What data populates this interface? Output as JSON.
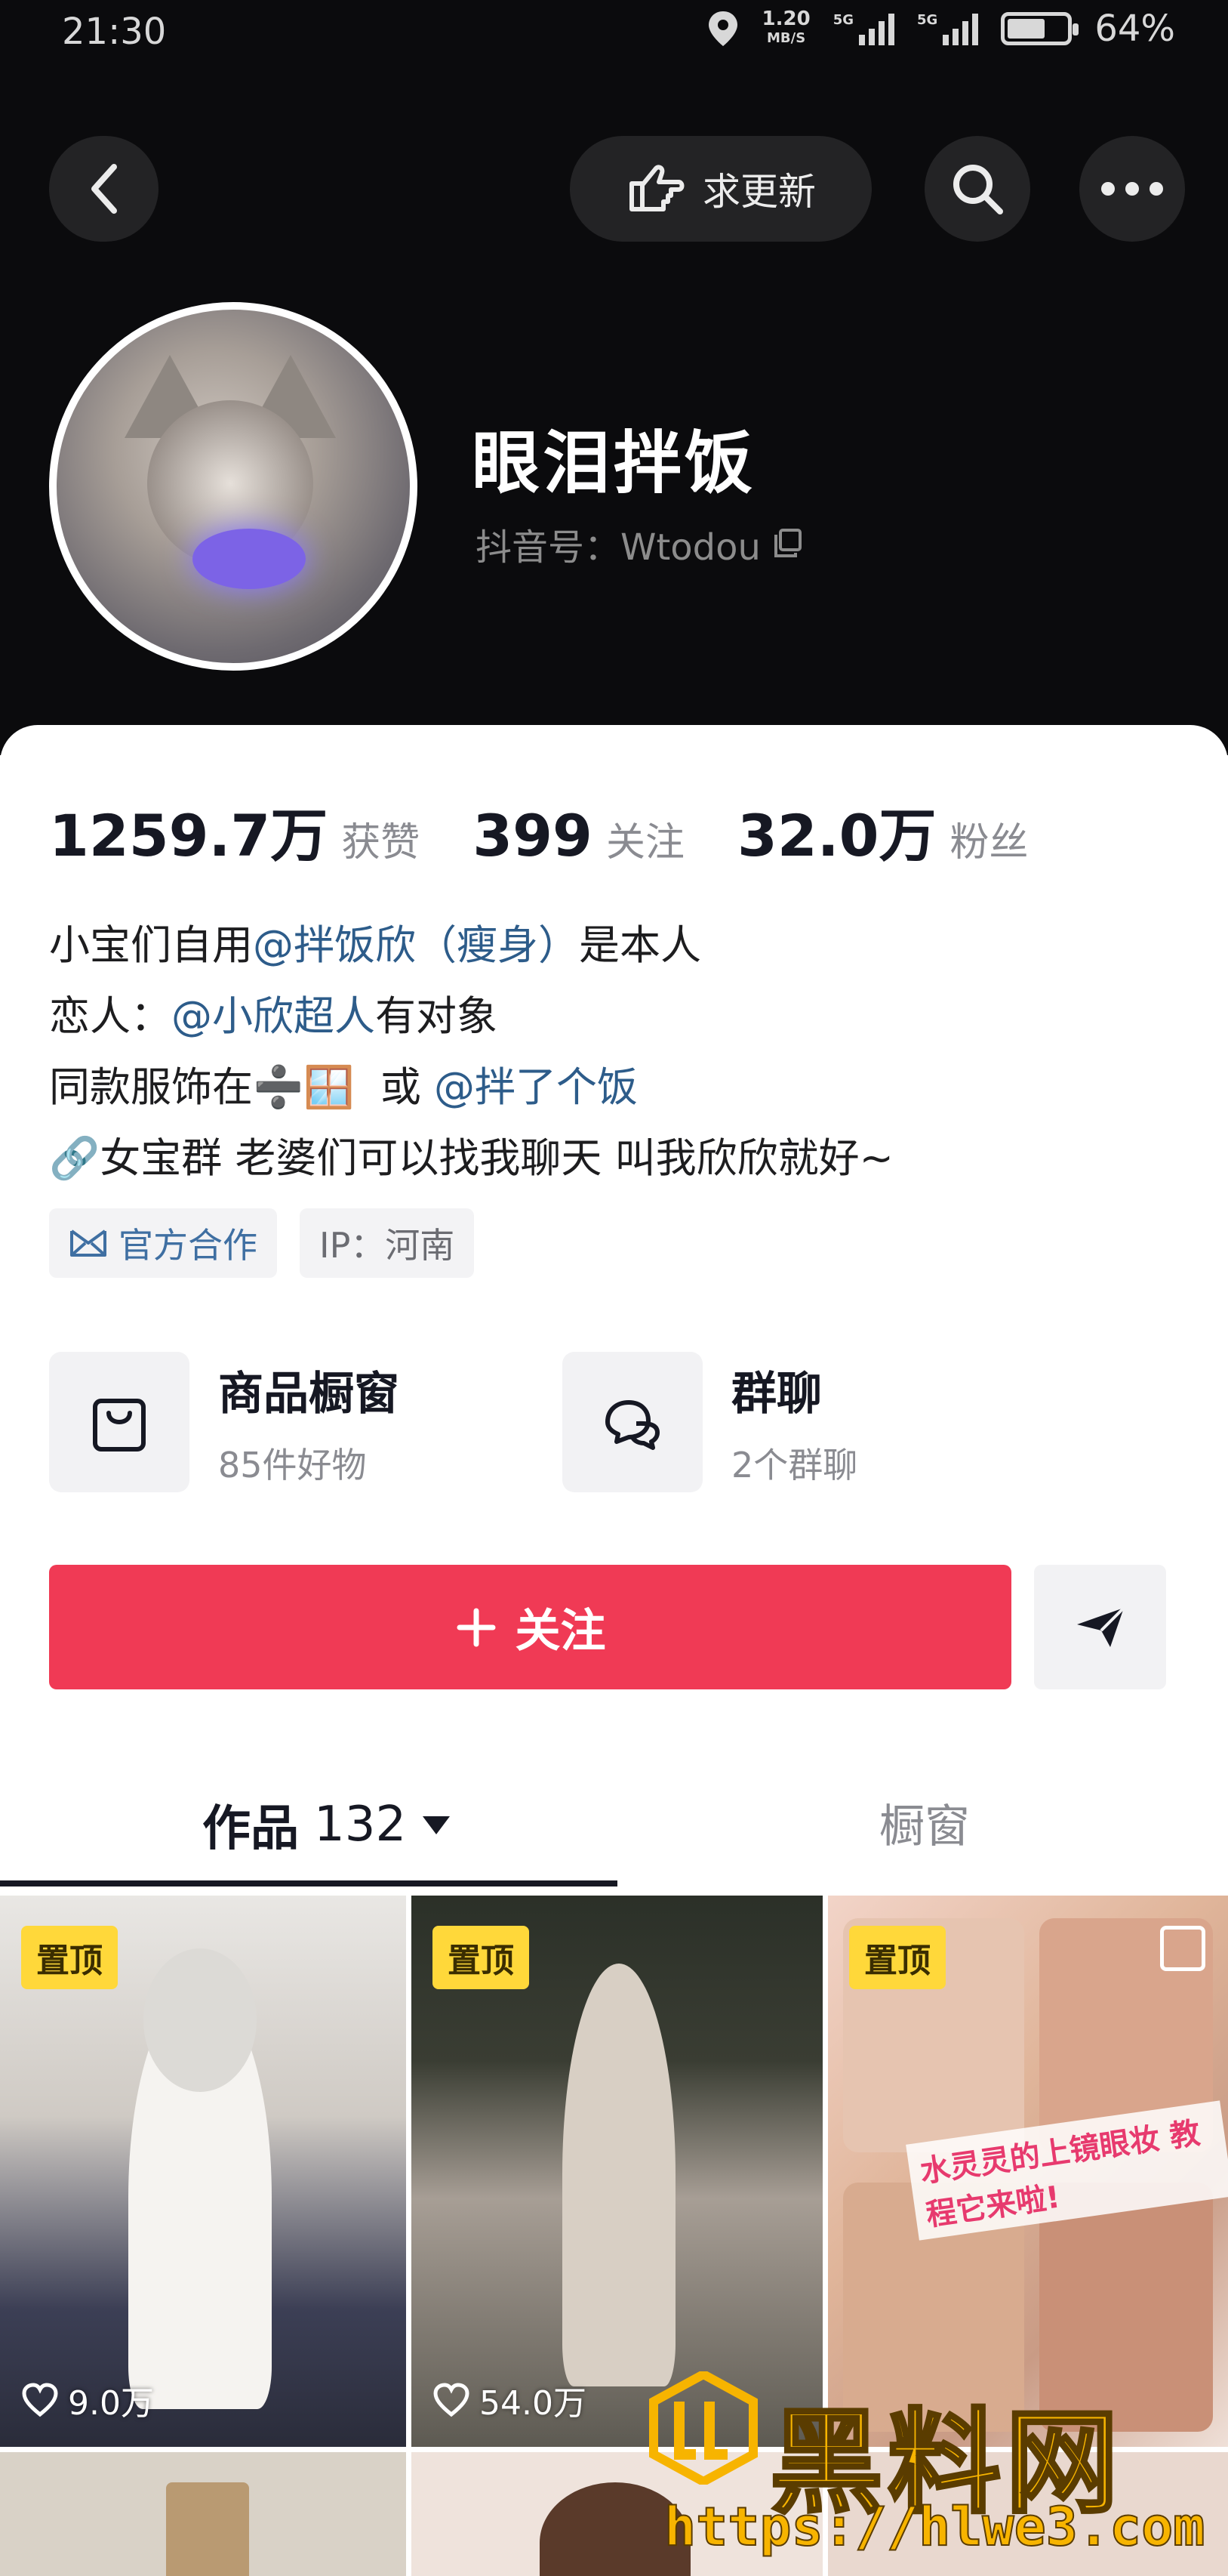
{
  "status": {
    "time": "21:30",
    "speed_value": "1.20",
    "speed_unit": "MB/S",
    "net1": "5G",
    "net2": "5G",
    "battery": "64%",
    "battery_level": 0.64
  },
  "header": {
    "update_label": "求更新"
  },
  "profile": {
    "name": "眼泪拌饭",
    "account": "抖音号：Wtodou"
  },
  "stats": {
    "likes_value": "1259.7万",
    "likes_label": "获赞",
    "following_value": "399",
    "following_label": "关注",
    "followers_value": "32.0万",
    "followers_label": "粉丝"
  },
  "bio": {
    "line1_prefix": "小宝们自用",
    "line1_mention": "@拌饭欣（瘦身）",
    "line1_suffix": " 是本人",
    "line2_prefix": "恋人：",
    "line2_mention": "@小欣超人",
    "line2_suffix": " 有对象",
    "line3_prefix": "同款服饰在",
    "line3_emoji": "➗🪟",
    "line3_mid": "  或 ",
    "line3_mention": "@拌了个饭",
    "line4_emoji": "🔗",
    "line4_text": "女宝群 老婆们可以找我聊天 叫我欣欣就好~"
  },
  "tags": {
    "official": "官方合作",
    "ip": "IP：河南"
  },
  "entries": [
    {
      "title": "商品橱窗",
      "sub": "85件好物"
    },
    {
      "title": "群聊",
      "sub": "2个群聊"
    }
  ],
  "follow_label": "关注",
  "tabs": {
    "works_label": "作品",
    "works_count": "132",
    "window_label": "橱窗"
  },
  "videos": [
    {
      "pin": "置顶",
      "likes": "9.0万"
    },
    {
      "pin": "置顶",
      "likes": "54.0万"
    },
    {
      "pin": "置顶",
      "caption": "水灵灵的上镜眼妆 教程它来啦!"
    }
  ],
  "watermark": {
    "brand": "黑料网",
    "url": "https://hlwe3.com"
  },
  "colors": {
    "follow_button": "#f03a55",
    "pin_badge": "#ffd83a",
    "mention": "#2d5c8a"
  }
}
